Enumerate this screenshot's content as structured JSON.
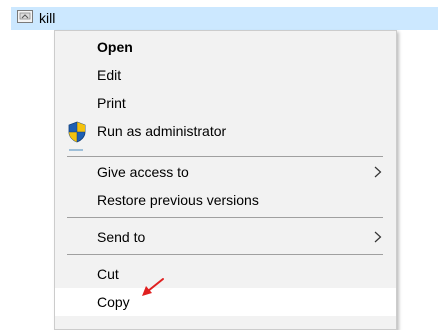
{
  "file": {
    "name": "kill",
    "icon": "shortcut-file-icon"
  },
  "context_menu": {
    "items": [
      {
        "label": "Open",
        "bold": true
      },
      {
        "label": "Edit"
      },
      {
        "label": "Print"
      },
      {
        "label": "Run as administrator",
        "icon": "uac-shield-icon"
      },
      {
        "label": "Give access to",
        "submenu": true
      },
      {
        "label": "Restore previous versions"
      },
      {
        "label": "Send to",
        "submenu": true
      },
      {
        "label": "Cut"
      },
      {
        "label": "Copy",
        "highlighted": true
      }
    ]
  },
  "colors": {
    "selection": "#cce8ff",
    "menu_background": "#f2f2f2",
    "annotation_arrow": "#e02020",
    "shield_blue": "#1e5fb4",
    "shield_yellow": "#f4c20d"
  }
}
